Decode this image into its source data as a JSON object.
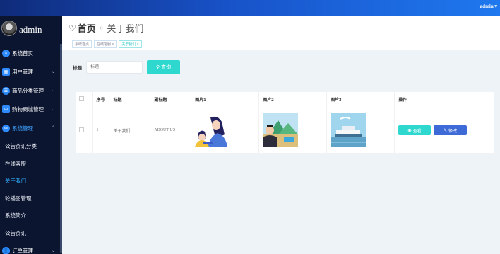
{
  "topbar": {
    "user": "admin ▾"
  },
  "sidebar": {
    "brand": "admin",
    "items": [
      {
        "label": "系统首页",
        "icon": "home-icon",
        "chevron": false
      },
      {
        "label": "用户管理",
        "icon": "grid-icon",
        "chevron": true
      },
      {
        "label": "商品分类管理",
        "icon": "list-icon",
        "chevron": true
      },
      {
        "label": "购物商城管理",
        "icon": "apps-icon",
        "chevron": true
      },
      {
        "label": "系统管理",
        "icon": "settings-icon",
        "chevron": true,
        "expanded": true
      }
    ],
    "subitems": [
      {
        "label": "公告资讯分类"
      },
      {
        "label": "在线客服"
      },
      {
        "label": "关于我们",
        "current": true
      },
      {
        "label": "轮播图管理"
      },
      {
        "label": "系统简介"
      },
      {
        "label": "公告资讯"
      }
    ],
    "last_item": {
      "label": "订单管理",
      "icon": "user-icon"
    }
  },
  "header": {
    "home": "首页",
    "separator": "»",
    "current": "关于我们",
    "tags": [
      "系统首页",
      "在线客服 ×",
      "关于我们 ×"
    ]
  },
  "search": {
    "label": "标题",
    "placeholder": "标题",
    "button": "查询"
  },
  "table": {
    "headers": [
      "",
      "序号",
      "标题",
      "副标题",
      "图片1",
      "图片2",
      "图片3",
      "操作"
    ],
    "rows": [
      {
        "index": "1",
        "title": "关于我们",
        "subtitle": "ABOUT US",
        "view": "查看",
        "edit": "修改"
      }
    ]
  },
  "colors": {
    "accent": "#2ed8cf",
    "edit": "#3e6ad8",
    "sidebar": "#0b1530",
    "topbar": "#1852c8"
  }
}
